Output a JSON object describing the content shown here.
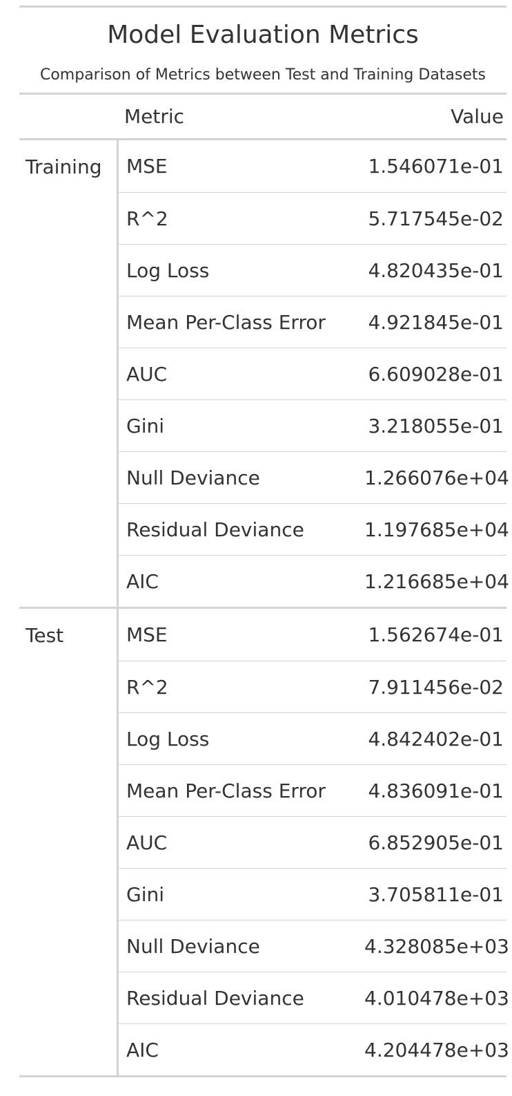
{
  "chart_data": {
    "type": "table",
    "title": "Model Evaluation Metrics",
    "subtitle": "Comparison of Metrics between Test and Training Datasets",
    "columns": [
      "Metric",
      "Value"
    ],
    "groups": [
      {
        "label": "Training",
        "rows": [
          {
            "metric": "MSE",
            "value": "1.546071e-01"
          },
          {
            "metric": "R^2",
            "value": "5.717545e-02"
          },
          {
            "metric": "Log Loss",
            "value": "4.820435e-01"
          },
          {
            "metric": "Mean Per-Class Error",
            "value": "4.921845e-01"
          },
          {
            "metric": "AUC",
            "value": "6.609028e-01"
          },
          {
            "metric": "Gini",
            "value": "3.218055e-01"
          },
          {
            "metric": "Null Deviance",
            "value": "1.266076e+04"
          },
          {
            "metric": "Residual Deviance",
            "value": "1.197685e+04"
          },
          {
            "metric": "AIC",
            "value": "1.216685e+04"
          }
        ]
      },
      {
        "label": "Test",
        "rows": [
          {
            "metric": "MSE",
            "value": "1.562674e-01"
          },
          {
            "metric": "R^2",
            "value": "7.911456e-02"
          },
          {
            "metric": "Log Loss",
            "value": "4.842402e-01"
          },
          {
            "metric": "Mean Per-Class Error",
            "value": "4.836091e-01"
          },
          {
            "metric": "AUC",
            "value": "6.852905e-01"
          },
          {
            "metric": "Gini",
            "value": "3.705811e-01"
          },
          {
            "metric": "Null Deviance",
            "value": "4.328085e+03"
          },
          {
            "metric": "Residual Deviance",
            "value": "4.010478e+03"
          },
          {
            "metric": "AIC",
            "value": "4.204478e+03"
          }
        ]
      }
    ]
  },
  "colors": {
    "text": "#333333",
    "rule": "#d3d3d3",
    "background": "#ffffff"
  }
}
